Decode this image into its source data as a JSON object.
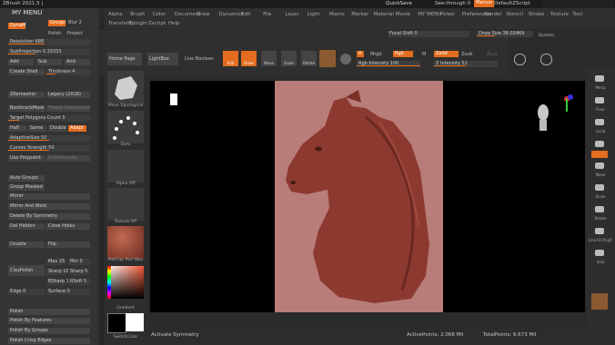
{
  "window": {
    "title": "ZBrush 2021.5 |",
    "quicksave": "QuickSave",
    "see_through": "See-through 0",
    "menus": "Menus",
    "script": "DefaultZScript"
  },
  "menu_row1": [
    "Alpha",
    "Brush",
    "Color",
    "Document",
    "Draw",
    "Dynamics",
    "Edit",
    "File",
    "Layer",
    "Light",
    "Macro",
    "Marker",
    "Material",
    "Movie",
    "MY MENU",
    "Picker",
    "Preferences",
    "Render",
    "Stencil",
    "Stroke",
    "Texture",
    "Tool"
  ],
  "menu_row2": [
    "Transform",
    "Zplugin",
    "Zscript",
    "Help"
  ],
  "left": {
    "title": "MY MENU",
    "dynamesh": "DynaMesh",
    "groups": "Groups",
    "blur": "Blur 2",
    "polish": "Polish",
    "project": "Project",
    "resolution": "Resolution 688",
    "subprojection": "SubProjection 0.33333",
    "add": "Add",
    "sub": "Sub",
    "and": "And",
    "create_shell": "Create Shell",
    "thickness": "Thickness 4",
    "zremesher": "ZRemesher",
    "legacy": "Legacy (2018)",
    "backtrackmask": "BacktrackMask",
    "freeze_subdivision": "Freeze SubdivisionLevels",
    "target_polygons": "Target Polygons Count 5",
    "half": "Half",
    "same": "Same",
    "double": "Double",
    "adapt": "Adapt",
    "adaptive_size": "AdaptiveSize 50",
    "curves_strength": "Curves Strength 50",
    "use_polypaint": "Use Polypaint",
    "color_density": "ColorDensity",
    "auto_groups": "Auto Groups",
    "group_masked": "Group Masked",
    "mirror": "Mirror",
    "mirror_weld": "Mirror And Weld",
    "delete_by_symmetry": "Delete By Symmetry",
    "del_hidden": "Del Hidden",
    "close_holes": "Close Holes",
    "double2": "Double",
    "flip": "Flip",
    "claypolish": "ClayPolish",
    "max": "Max 25",
    "min": "Min 0",
    "sharp": "Sharp 10",
    "sharp2": "Sharp 5",
    "bsharp": "BSharp 10",
    "rsoft": "RSoft 5",
    "edge": "Edge 0",
    "surface": "Surface 0",
    "polish_head": "Polish",
    "polish_features": "Polish By Features",
    "polish_groups": "Polish By Groups",
    "polish_crisp": "Polish Crisp Edges"
  },
  "toolbar": {
    "home_page": "Home Page",
    "lightbox": "LightBox",
    "live_boolean": "Live Boolean",
    "edit": "Edit",
    "draw": "Draw",
    "move": "Move",
    "scale": "Scale",
    "rotate": "Rotate",
    "a": "A",
    "mrgb": "Mrgb",
    "rgb": "Rgb",
    "m": "M",
    "zadd": "Zadd",
    "zsub": "Zsub",
    "zcut": "Zcut",
    "rgb_intensity": "Rgb Intensity 100",
    "z_intensity": "Z Intensity 51",
    "focal_shift": "Focal Shift 0",
    "draw_size": "Draw Size 38.02469",
    "dynamic": "Dynamic"
  },
  "shelf": {
    "brush": "Move Topological",
    "stroke": "Dots",
    "alpha": "Alpha Off",
    "texture": "Texture Off",
    "material": "MatCap Red Wax",
    "gradient": "Gradient",
    "switch_color": "SwitchColor"
  },
  "right": [
    "Persp",
    "Floor",
    "Local",
    "Frame",
    "Move",
    "Scale",
    "Rotate",
    "Line Fill PolyF",
    "Solo"
  ],
  "bottom": {
    "symmetry": "Activate Symmetry",
    "active_points": "ActivePoints: 2.068 Mil",
    "total_points": "TotalPoints: 6.673 Mil"
  },
  "colors": {
    "accent": "#e46c1e",
    "doc": "#b97d79",
    "model": "#8c3a30"
  }
}
